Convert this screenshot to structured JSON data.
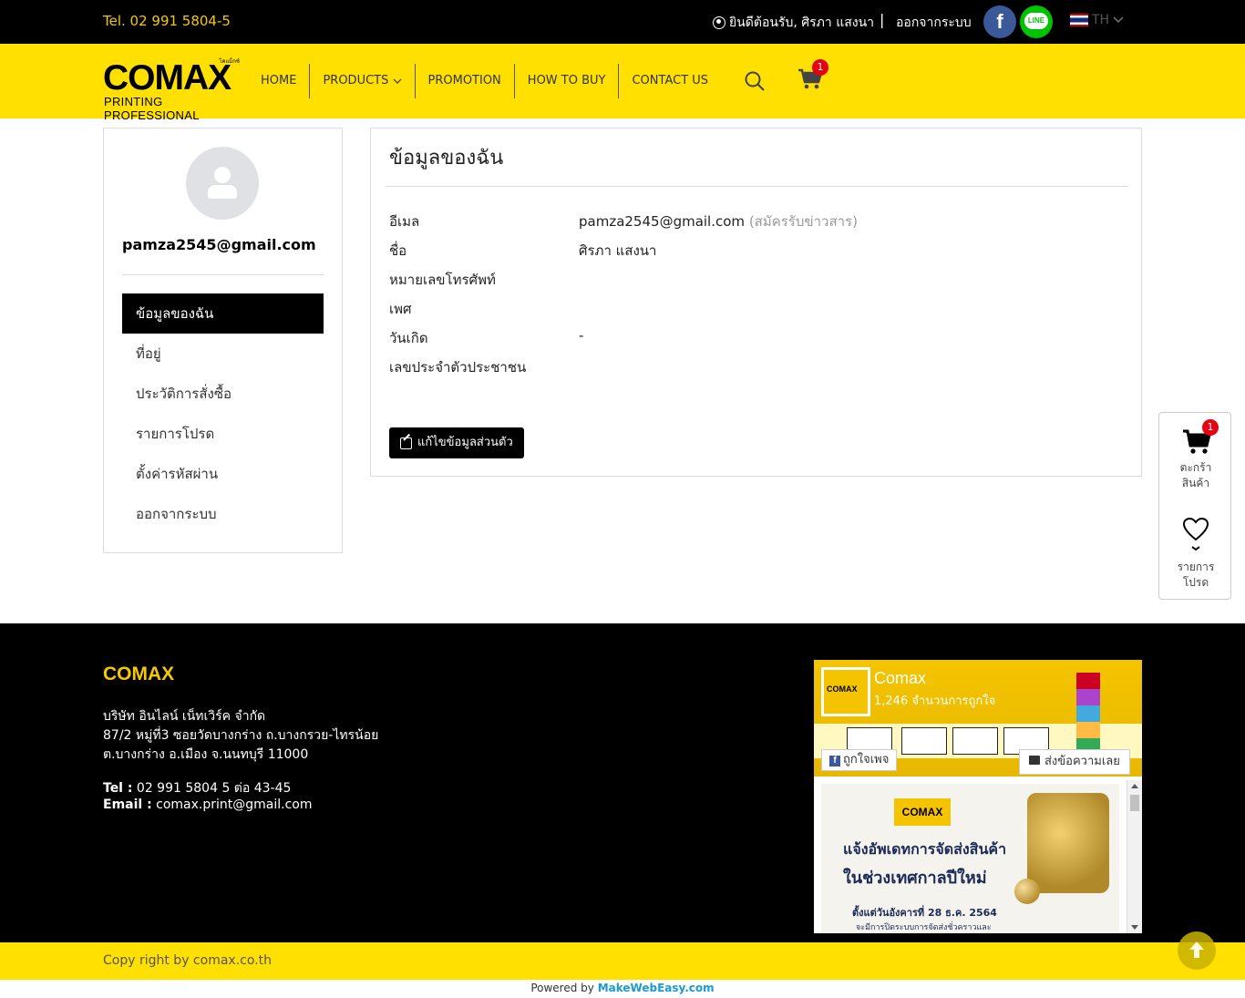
{
  "topbar": {
    "tel": "Tel. 02 991 5804-5",
    "welcome": "ยินดีต้อนรับ, ศิรภา แสงนา",
    "separator": "|",
    "logout": "ออกจากระบบ",
    "lang": "TH"
  },
  "logo": {
    "thai": "โคแม็กซ์",
    "big": "COMAX",
    "small": "PRINTING PROFESSIONAL"
  },
  "nav": {
    "home": "HOME",
    "products": "PRODUCTS",
    "promotion": "PROMOTION",
    "how_to_buy": "HOW TO BUY",
    "contact": "CONTACT US",
    "cart_count": "1"
  },
  "sidebar": {
    "email": "pamza2545@gmail.com",
    "items": [
      {
        "label": "ข้อมูลของฉัน"
      },
      {
        "label": "ที่อยู่"
      },
      {
        "label": "ประวัติการสั่งซื้อ"
      },
      {
        "label": "รายการโปรด"
      },
      {
        "label": "ตั้งค่ารหัสผ่าน"
      },
      {
        "label": "ออกจากระบบ"
      }
    ]
  },
  "profile": {
    "title": "ข้อมูลของฉัน",
    "email_label": "อีเมล",
    "email_value": "pamza2545@gmail.com",
    "email_note": "(สมัครรับข่าวสาร)",
    "name_label": "ชื่อ",
    "name_value": "ศิรภา แสงนา",
    "phone_label": "หมายเลขโทรศัพท์",
    "gender_label": "เพศ",
    "birthday_label": "วันเกิด",
    "birthday_value": "-",
    "id_label": "เลขประจำตัวประชาชน",
    "edit_button": "แก้ไขข้อมูลส่วนตัว"
  },
  "float_panel": {
    "cart_count": "1",
    "cart_label_1": "ตะกร้า",
    "cart_label_2": "สินค้า",
    "fav_label_1": "รายการ",
    "fav_label_2": "โปรด"
  },
  "footer": {
    "brand": "COMAX",
    "company": "บริษัท อินไลน์ เน็ทเวิร์ค จำกัด",
    "address_1": "87/2 หมู่ที่3 ซอยวัดบางกร่าง ถ.บางกรวย-ไทรน้อย",
    "address_2": "ต.บางกร่าง อ.เมือง จ.นนทบุรี 11000",
    "tel_label": "Tel :",
    "tel_value": "02 991 5804 5 ต่อ 43-45",
    "email_label": "Email :",
    "email_value": "comax.print@gmail.com",
    "fb_thumb": "COMAX",
    "fb_name": "Comax",
    "fb_likes": "1,246 จำนวนการถูกใจ",
    "fb_like_btn": "ถูกใจเพจ",
    "fb_msg_btn": "ส่งข้อความเลย",
    "post_logo": "COMAX",
    "post_line1": "แจ้งอัพเดทการจัดส่งสินค้า",
    "post_line2": "ในช่วงเทศกาลปีใหม่",
    "post_line3": "ตั้งแต่วันอังคารที่ 28 ธ.ค. 2564",
    "post_line4": "จะมีการปิดระบบการจัดส่งชั่วคราวและ",
    "copyright": "Copy right by comax.co.th",
    "powered_by": "Powered by",
    "powered_brand": "MakeWebEasy.com"
  },
  "colors": {
    "brand_yellow": "#ffe000",
    "badge_red": "#e60012",
    "facebook": "#3b5998",
    "line": "#00c300"
  }
}
